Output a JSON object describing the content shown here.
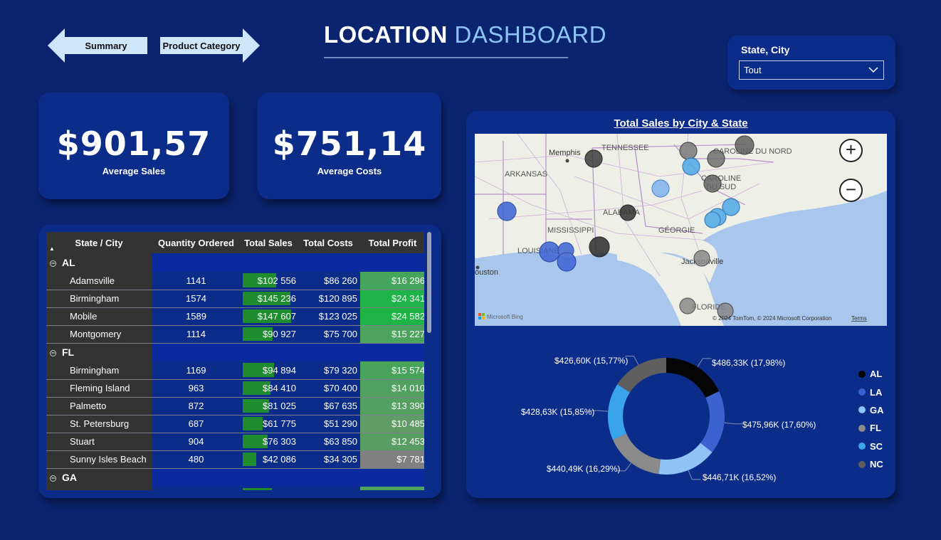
{
  "nav": {
    "back_label": "Summary",
    "forward_label": "Product Category"
  },
  "title": {
    "word1": "LOCATION",
    "word2": "DASHBOARD"
  },
  "slicer": {
    "label": "State, City",
    "value": "Tout"
  },
  "kpis": [
    {
      "value": "$901,57",
      "label": "Average Sales"
    },
    {
      "value": "$751,14",
      "label": "Average Costs"
    }
  ],
  "table": {
    "columns": [
      "State / City",
      "Quantity Ordered",
      "Total Sales",
      "Total Costs",
      "Total Profit"
    ],
    "groups": [
      {
        "state": "AL",
        "rows": [
          {
            "city": "Adamsville",
            "qty": "1141",
            "sales": "$102 556",
            "costs": "$86 260",
            "profit": "$16 296",
            "sales_num": 102556,
            "profit_num": 16296
          },
          {
            "city": "Birmingham",
            "qty": "1574",
            "sales": "$145 236",
            "costs": "$120 895",
            "profit": "$24 341",
            "sales_num": 145236,
            "profit_num": 24341
          },
          {
            "city": "Mobile",
            "qty": "1589",
            "sales": "$147 607",
            "costs": "$123 025",
            "profit": "$24 582",
            "sales_num": 147607,
            "profit_num": 24582
          },
          {
            "city": "Montgomery",
            "qty": "1114",
            "sales": "$90 927",
            "costs": "$75 700",
            "profit": "$15 227",
            "sales_num": 90927,
            "profit_num": 15227
          }
        ]
      },
      {
        "state": "FL",
        "rows": [
          {
            "city": "Birmingham",
            "qty": "1169",
            "sales": "$94 894",
            "costs": "$79 320",
            "profit": "$15 574",
            "sales_num": 94894,
            "profit_num": 15574
          },
          {
            "city": "Fleming Island",
            "qty": "963",
            "sales": "$84 410",
            "costs": "$70 400",
            "profit": "$14 010",
            "sales_num": 84410,
            "profit_num": 14010
          },
          {
            "city": "Palmetto",
            "qty": "872",
            "sales": "$81 025",
            "costs": "$67 635",
            "profit": "$13 390",
            "sales_num": 81025,
            "profit_num": 13390
          },
          {
            "city": "St. Petersburg",
            "qty": "687",
            "sales": "$61 775",
            "costs": "$51 290",
            "profit": "$10 485",
            "sales_num": 61775,
            "profit_num": 10485
          },
          {
            "city": "Stuart",
            "qty": "904",
            "sales": "$76 303",
            "costs": "$63 850",
            "profit": "$12 453",
            "sales_num": 76303,
            "profit_num": 12453
          },
          {
            "city": "Sunny Isles Beach",
            "qty": "480",
            "sales": "$42 086",
            "costs": "$34 305",
            "profit": "$7 781",
            "sales_num": 42086,
            "profit_num": 7781
          }
        ]
      },
      {
        "state": "GA",
        "rows": [
          {
            "city": "",
            "qty": "",
            "sales": "",
            "costs": "",
            "profit": "",
            "sales_num": 90000,
            "profit_num": 15000
          }
        ]
      }
    ]
  },
  "map": {
    "title": "Total Sales by City & State",
    "labels": [
      "TENNESSEE",
      "Memphis",
      "ARKANSAS",
      "CAROLINE DU NORD",
      "CAROLINE",
      "DU SUD",
      "ALABAMA",
      "MISSISSIPPI",
      "GÉORGIE",
      "LOUISIANE",
      "ouston",
      "Jacksonville",
      "FLORIDE"
    ],
    "attribution": "© 2024 TomTom, © 2024 Microsoft Corporation",
    "terms": "Terms",
    "brand": "Microsoft Bing",
    "zoom_in": "+",
    "zoom_out": "−"
  },
  "chart_data": {
    "type": "pie",
    "donut": true,
    "categories": [
      "AL",
      "LA",
      "GA",
      "FL",
      "SC",
      "NC"
    ],
    "values": [
      486.33,
      475.96,
      446.71,
      440.49,
      428.63,
      426.6
    ],
    "percents": [
      17.98,
      17.6,
      16.52,
      16.29,
      15.85,
      15.77
    ],
    "data_labels": [
      "$486,33K (17,98%)",
      "$475,96K (17,60%)",
      "$446,71K (16,52%)",
      "$440,49K (16,29%)",
      "$428,63K (15,85%)",
      "$426,60K (15,77%)"
    ],
    "colors": [
      "#050505",
      "#3a63d0",
      "#8fc3f5",
      "#8a8a8a",
      "#3aa4ea",
      "#5f5f5f"
    ],
    "legend_position": "right"
  }
}
